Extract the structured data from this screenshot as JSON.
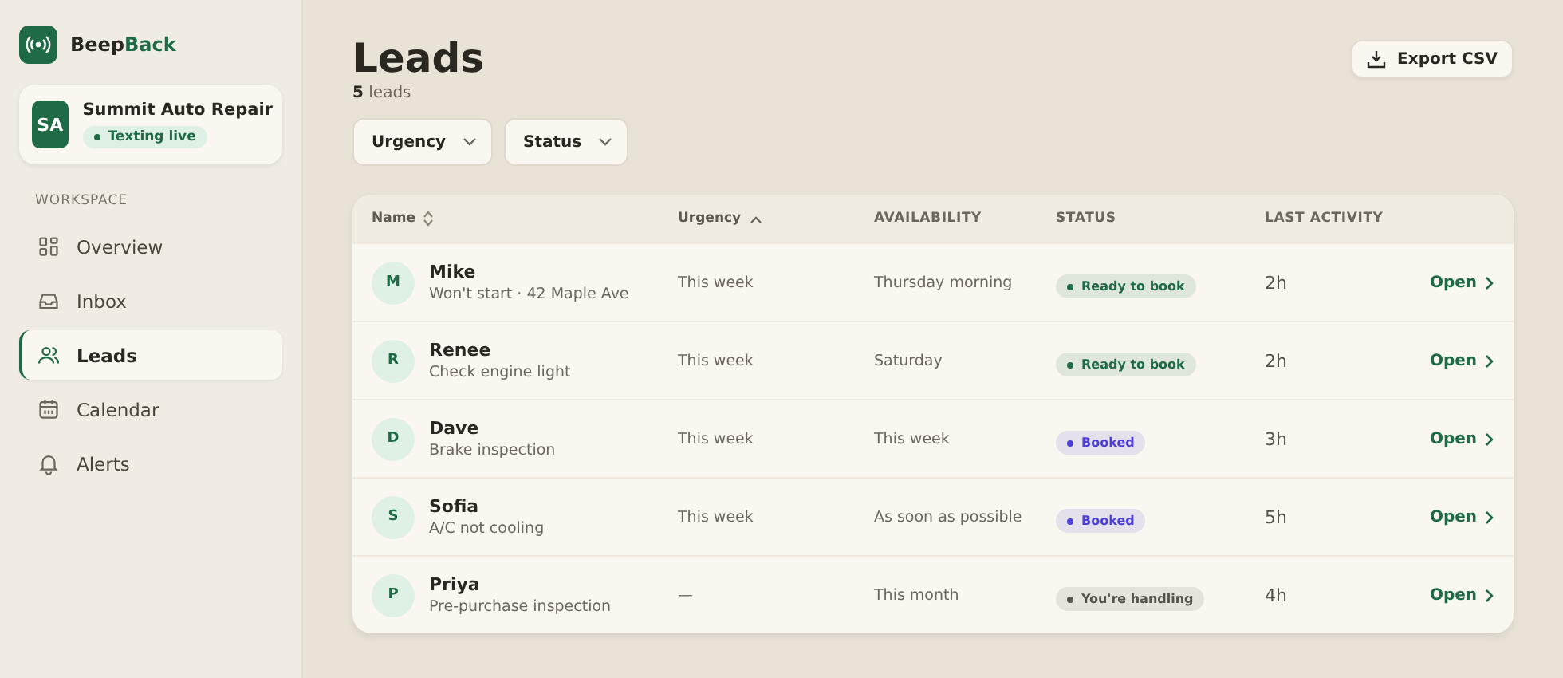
{
  "brand": {
    "name_part1": "Beep",
    "name_part2": "Back"
  },
  "account": {
    "initials": "SA",
    "name": "Summit Auto Repair",
    "status": "Texting live",
    "live": true
  },
  "sidebar": {
    "section": "WORKSPACE",
    "items": [
      {
        "label": "Overview",
        "selected": false
      },
      {
        "label": "Inbox",
        "selected": false
      },
      {
        "label": "Leads",
        "selected": true
      },
      {
        "label": "Calendar",
        "selected": false
      },
      {
        "label": "Alerts",
        "selected": false
      }
    ]
  },
  "page": {
    "title": "Leads",
    "count": "**5** leads",
    "export": "Export CSV"
  },
  "filters": [
    "Urgency",
    "Status"
  ],
  "table": {
    "columns": [
      {
        "label": "Name",
        "sortable": true,
        "sorted": false
      },
      {
        "label": "Urgency",
        "sortable": true,
        "sorted": true
      },
      {
        "label": "AVAILABILITY",
        "sortable": false,
        "sorted": false
      },
      {
        "label": "STATUS",
        "sortable": false,
        "sorted": false
      },
      {
        "label": "LAST ACTIVITY",
        "sortable": false,
        "sorted": false
      }
    ],
    "rows": [
      {
        "initial": "M",
        "name": "Mike",
        "issue": "Won't start · 42 Maple Ave",
        "urgency": "This week",
        "availability": "Thursday morning",
        "status": "Ready to book",
        "color": "#1f6b45",
        "activity": "2h",
        "action": "Open"
      },
      {
        "initial": "R",
        "name": "Renee",
        "issue": "Check engine light",
        "urgency": "This week",
        "availability": "Saturday",
        "status": "Ready to book",
        "color": "#1f6b45",
        "activity": "2h",
        "action": "Open"
      },
      {
        "initial": "D",
        "name": "Dave",
        "issue": "Brake inspection",
        "urgency": "This week",
        "availability": "This week",
        "status": "Booked",
        "color": "#4b3fd8",
        "activity": "3h",
        "action": "Open"
      },
      {
        "initial": "S",
        "name": "Sofia",
        "issue": "A/C not cooling",
        "urgency": "This week",
        "availability": "As soon as possible",
        "status": "Booked",
        "color": "#4b3fd8",
        "activity": "5h",
        "action": "Open"
      },
      {
        "initial": "P",
        "name": "Priya",
        "issue": "Pre-purchase inspection",
        "urgency": "—",
        "availability": "This month",
        "status": "You're handling",
        "color": "#57524a",
        "activity": "4h",
        "action": "Open"
      }
    ]
  }
}
